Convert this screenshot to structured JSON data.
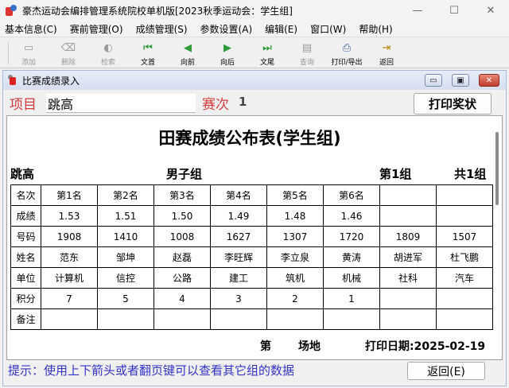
{
  "window": {
    "title": "豪杰运动会编排管理系统院校单机版[2023秋季运动会：学生组]",
    "minimize": "—",
    "maximize": "☐",
    "close": "✕"
  },
  "menu": [
    {
      "label": "基本信息(C)"
    },
    {
      "label": "赛前管理(O)"
    },
    {
      "label": "成绩管理(S)"
    },
    {
      "label": "参数设置(A)"
    },
    {
      "label": "编辑(E)"
    },
    {
      "label": "窗口(W)"
    },
    {
      "label": "帮助(H)"
    }
  ],
  "toolbar": [
    {
      "label": "添加",
      "icon": "add-doc-icon",
      "glyph": "▭",
      "enabled": false
    },
    {
      "label": "删除",
      "icon": "eraser-icon",
      "glyph": "⌫",
      "enabled": false
    },
    {
      "label": "检索",
      "icon": "search-icon",
      "glyph": "◐",
      "enabled": false
    },
    {
      "label": "文首",
      "icon": "first-icon",
      "glyph": "⏮",
      "enabled": true
    },
    {
      "label": "向前",
      "icon": "prev-icon",
      "glyph": "◀",
      "enabled": true
    },
    {
      "label": "向后",
      "icon": "next-icon",
      "glyph": "▶",
      "enabled": true
    },
    {
      "label": "文尾",
      "icon": "last-icon",
      "glyph": "⏭",
      "enabled": true
    },
    {
      "label": "查询",
      "icon": "query-icon",
      "glyph": "▤",
      "enabled": false
    },
    {
      "label": "打印/导出",
      "icon": "printer-icon",
      "glyph": "⎙",
      "enabled": true
    },
    {
      "label": "返回",
      "icon": "exit-door-icon",
      "glyph": "⇥",
      "enabled": true
    }
  ],
  "child": {
    "title": "比赛成绩录入",
    "min": "▭",
    "max": "▣",
    "close": "✕",
    "event_label": "项目",
    "event_value": "跳高",
    "round_label": "赛次",
    "round_value": "1",
    "print_button": "打印奖状",
    "hint": "提示：使用上下箭头或者翻页键可以查看其它组的数据",
    "back_button": "返回(E)"
  },
  "report": {
    "title": "田赛成绩公布表(学生组)",
    "event": "跳高",
    "group_gender": "男子组",
    "group_no": "第1组",
    "total_groups": "共1组",
    "rows": [
      {
        "label": "名次",
        "cells": [
          "第1名",
          "第2名",
          "第3名",
          "第4名",
          "第5名",
          "第6名",
          "",
          ""
        ]
      },
      {
        "label": "成绩",
        "cells": [
          "1.53",
          "1.51",
          "1.50",
          "1.49",
          "1.48",
          "1.46",
          "",
          ""
        ]
      },
      {
        "label": "号码",
        "cells": [
          "1908",
          "1410",
          "1008",
          "1627",
          "1307",
          "1720",
          "1809",
          "1507"
        ]
      },
      {
        "label": "姓名",
        "cells": [
          "范东",
          "邹坤",
          "赵磊",
          "李旺辉",
          "李立泉",
          "黄涛",
          "胡进军",
          "杜飞鹏"
        ]
      },
      {
        "label": "单位",
        "cells": [
          "计算机",
          "信控",
          "公路",
          "建工",
          "筑机",
          "机械",
          "社科",
          "汽车"
        ]
      },
      {
        "label": "积分",
        "cells": [
          "7",
          "5",
          "4",
          "3",
          "2",
          "1",
          "",
          ""
        ]
      },
      {
        "label": "备注",
        "cells": [
          "",
          "",
          "",
          "",
          "",
          "",
          "",
          ""
        ]
      }
    ],
    "venue_prefix": "第",
    "venue_suffix": "场地",
    "print_date": "打印日期:2025-02-19"
  }
}
